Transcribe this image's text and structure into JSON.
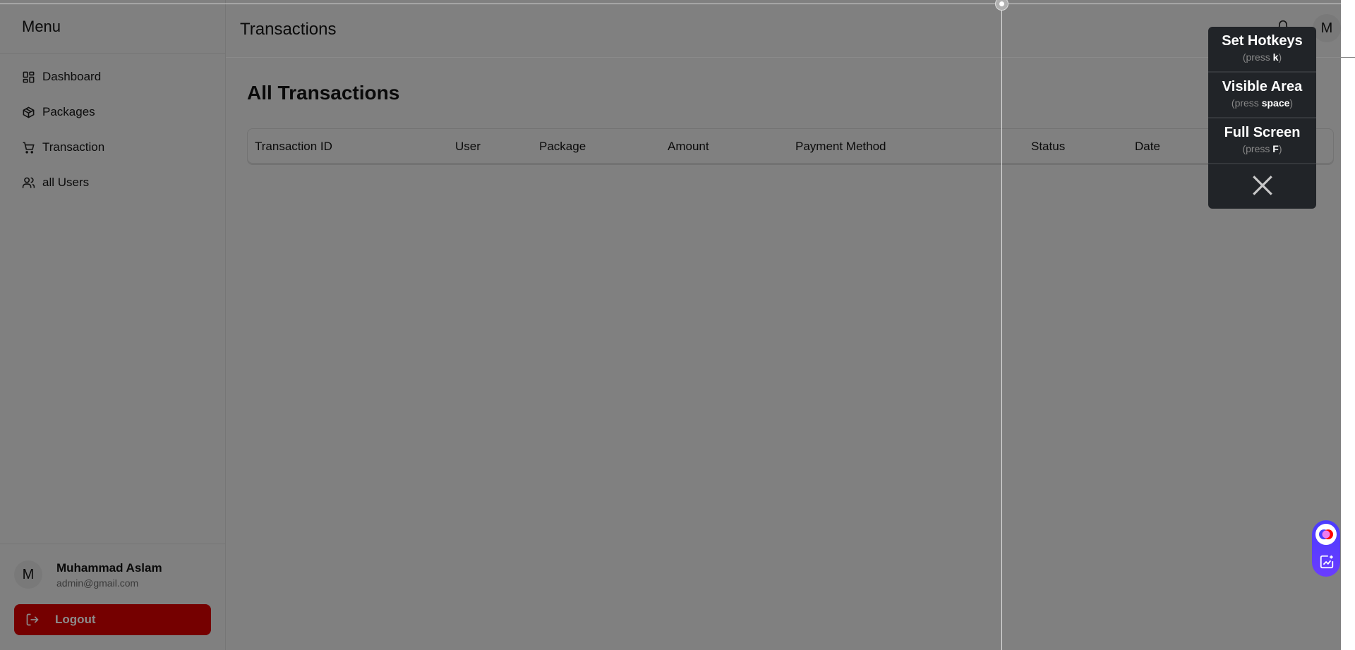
{
  "sidebar": {
    "title": "Menu",
    "items": [
      {
        "label": "Dashboard",
        "icon": "dashboard-icon"
      },
      {
        "label": "Packages",
        "icon": "package-icon"
      },
      {
        "label": "Transaction",
        "icon": "cart-icon"
      },
      {
        "label": "all Users",
        "icon": "users-icon"
      }
    ],
    "user": {
      "initial": "M",
      "name": "Muhammad Aslam",
      "email": "admin@gmail.com"
    },
    "logout_label": "Logout"
  },
  "header": {
    "title": "Transactions",
    "avatar_initial": "M"
  },
  "main": {
    "title": "All Transactions",
    "columns": [
      "Transaction ID",
      "User",
      "Package",
      "Amount",
      "Payment Method",
      "Status",
      "Date"
    ]
  },
  "hotkey_popup": {
    "items": [
      {
        "title": "Set Hotkeys",
        "hint_prefix": "(press ",
        "key": "k",
        "hint_suffix": ")"
      },
      {
        "title": "Visible Area",
        "hint_prefix": "(press ",
        "key": "space",
        "hint_suffix": ")"
      },
      {
        "title": "Full Screen",
        "hint_prefix": "(press ",
        "key": "F",
        "hint_suffix": ")"
      }
    ]
  },
  "colors": {
    "overlay": "#808080",
    "logout": "#750000",
    "popup": "#212428",
    "widget": "#4a3cff"
  }
}
